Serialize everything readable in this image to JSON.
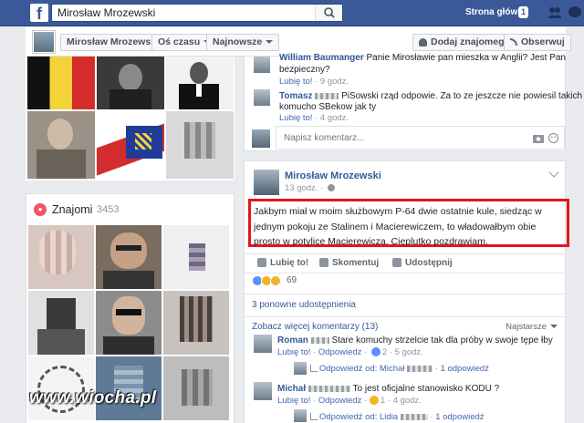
{
  "topbar": {
    "logo": "f",
    "search_value": "Mirosław Mrozewski",
    "home_label": "Strona główna",
    "home_count": "1"
  },
  "profile_nav": {
    "name": "Mirosław Mrozewski",
    "timeline": "Oś czasu",
    "newest": "Najnowsze",
    "add_friend": "Dodaj znajomego",
    "follow": "Obserwuj"
  },
  "friends": {
    "title": "Znajomi",
    "count": "3453"
  },
  "watermark": "www.wiocha.pl",
  "top_comments": [
    {
      "author": "William Baumanger",
      "text": "Panie Mirosławie pan mieszka w Anglii? Jest Pan",
      "text2": "bezpieczny?",
      "like": "Lubię to!",
      "time": "9 godz."
    },
    {
      "author": "Tomasz",
      "text": "PiSowski rząd odpowie. Za to ze jeszcze nie powiesil takich",
      "text2": "komucho SBekow jak ty",
      "like": "Lubię to!",
      "time": "4 godz."
    }
  ],
  "write_comment_placeholder": "Napisz komentarz...",
  "post": {
    "author": "Mirosław Mrozewski",
    "time": "13 godz.",
    "text": "Jakbym miał w moim służbowym P-64 dwie ostatnie kule, siedząc w jednym pokoju ze Stalinem i Macierewiczem, to władowałbym obie prosto w potylice Macierewicza. Cieplutko pozdrawiam.",
    "like_action": "Lubię to!",
    "comment_action": "Skomentuj",
    "share_action": "Udostępnij",
    "reaction_count": "69",
    "shares": "3 ponowne udostępnienia",
    "more_comments": "Zobacz więcej komentarzy (13)",
    "order_label": "Najstarsze"
  },
  "post_comments": [
    {
      "author": "Roman",
      "text": "Stare komuchy strzelcie tak dla próby w swoje tępe łby",
      "like": "Lubię to!",
      "reply": "Odpowiedz",
      "likes": "2",
      "time": "5 godz.",
      "reply_author": "Michał",
      "reply_link": "Odpowiedź od: Michał",
      "reply_count": "1 odpowiedź"
    },
    {
      "author": "Michał",
      "text": "To jest oficjalne stanowisko KODU ?",
      "like": "Lubię to!",
      "reply": "Odpowiedz",
      "likes": "1",
      "time": "4 godz.",
      "reply_link": "Odpowiedź od: Lidia",
      "reply_count": "1 odpowiedź"
    }
  ],
  "colors": {
    "fb_blue": "#3b5998",
    "link": "#365899",
    "highlight": "#e4151c"
  }
}
